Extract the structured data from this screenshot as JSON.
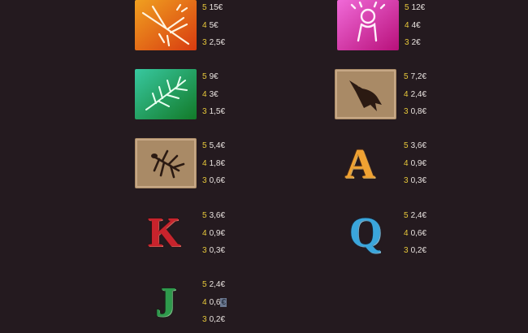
{
  "paytable": {
    "symbols": [
      {
        "id": "hummingbird",
        "icon": "hummingbird-geoglyph-icon",
        "pays": [
          {
            "count": "5",
            "value": "15€"
          },
          {
            "count": "4",
            "value": "5€"
          },
          {
            "count": "3",
            "value": "2,5€"
          }
        ]
      },
      {
        "id": "astronaut",
        "icon": "astronaut-geoglyph-icon",
        "pays": [
          {
            "count": "5",
            "value": "12€"
          },
          {
            "count": "4",
            "value": "4€"
          },
          {
            "count": "3",
            "value": "2€"
          }
        ]
      },
      {
        "id": "tree",
        "icon": "tree-geoglyph-icon",
        "pays": [
          {
            "count": "5",
            "value": "9€"
          },
          {
            "count": "4",
            "value": "3€"
          },
          {
            "count": "3",
            "value": "1,5€"
          }
        ]
      },
      {
        "id": "fish",
        "icon": "fish-geoglyph-icon",
        "pays": [
          {
            "count": "5",
            "value": "7,2€"
          },
          {
            "count": "4",
            "value": "2,4€"
          },
          {
            "count": "3",
            "value": "0,8€"
          }
        ]
      },
      {
        "id": "spider",
        "icon": "spider-geoglyph-icon",
        "pays": [
          {
            "count": "5",
            "value": "5,4€"
          },
          {
            "count": "4",
            "value": "1,8€"
          },
          {
            "count": "3",
            "value": "0,6€"
          }
        ]
      },
      {
        "id": "A",
        "letter": "A",
        "icon": "letter-a-icon",
        "pays": [
          {
            "count": "5",
            "value": "3,6€"
          },
          {
            "count": "4",
            "value": "0,9€"
          },
          {
            "count": "3",
            "value": "0,3€"
          }
        ]
      },
      {
        "id": "K",
        "letter": "K",
        "icon": "letter-k-icon",
        "pays": [
          {
            "count": "5",
            "value": "3,6€"
          },
          {
            "count": "4",
            "value": "0,9€"
          },
          {
            "count": "3",
            "value": "0,3€"
          }
        ]
      },
      {
        "id": "Q",
        "letter": "Q",
        "icon": "letter-q-icon",
        "pays": [
          {
            "count": "5",
            "value": "2,4€"
          },
          {
            "count": "4",
            "value": "0,6€"
          },
          {
            "count": "3",
            "value": "0,2€"
          }
        ]
      },
      {
        "id": "J",
        "letter": "J",
        "icon": "letter-j-icon",
        "pays": [
          {
            "count": "5",
            "value": "2,4€"
          },
          {
            "count": "4",
            "value": "0,6",
            "selected_suffix": "€"
          },
          {
            "count": "3",
            "value": "0,2€"
          }
        ]
      }
    ]
  },
  "colors": {
    "background": "#241a1f",
    "count": "#e8c93a",
    "value": "#e8e2df",
    "selection": "#6b7890"
  }
}
